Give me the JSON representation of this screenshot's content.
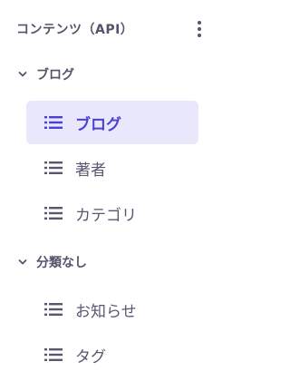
{
  "panel": {
    "title": "コンテンツ（API）",
    "more_icon": "more-vertical-icon"
  },
  "colors": {
    "accent": "#4b3fd6",
    "active_bg": "#e9e7fb",
    "text": "#5a5670"
  },
  "groups": [
    {
      "label": "ブログ",
      "expanded": true,
      "items": [
        {
          "label": "ブログ",
          "icon": "list-icon",
          "active": true
        },
        {
          "label": "著者",
          "icon": "list-icon",
          "active": false
        },
        {
          "label": "カテゴリ",
          "icon": "list-icon",
          "active": false
        }
      ]
    },
    {
      "label": "分類なし",
      "expanded": true,
      "items": [
        {
          "label": "お知らせ",
          "icon": "list-icon",
          "active": false
        },
        {
          "label": "タグ",
          "icon": "list-icon",
          "active": false
        }
      ]
    }
  ]
}
